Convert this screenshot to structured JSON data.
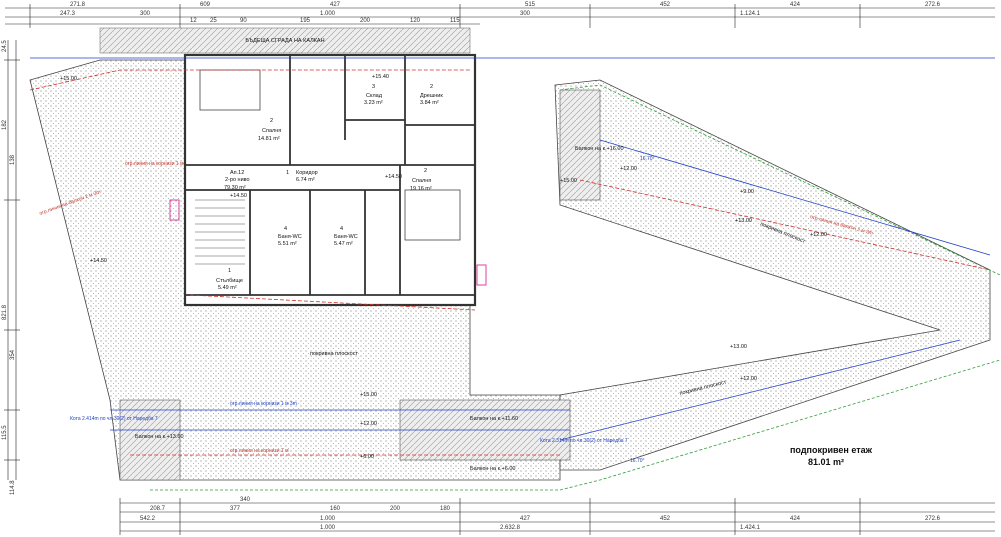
{
  "plan": {
    "floor_title": "подпокривен етаж",
    "floor_area": "81.01 m²",
    "neighbor_building": "БЪДЕЩА СГРАДА НА КАЛКАН",
    "apartment": {
      "name": "Ап.12",
      "type": "2-ро ниво",
      "area": "79.30 m²",
      "level": "+14.50"
    },
    "rooms": [
      {
        "id": "bedroom_1",
        "num": "2",
        "name": "Спалня",
        "area": "14.81 m²"
      },
      {
        "id": "storage",
        "num": "3",
        "name": "Склад",
        "area": "3.23 m²"
      },
      {
        "id": "dressing",
        "num": "2",
        "name": "Дрешник",
        "area": "3.84 m²"
      },
      {
        "id": "corridor",
        "num": "1",
        "name": "Коридор",
        "area": "6.74 m²"
      },
      {
        "id": "bedroom_2",
        "num": "2",
        "name": "Спалня",
        "area": "19.16 m²"
      },
      {
        "id": "bath_1",
        "num": "4",
        "name": "Баня-WC",
        "area": "5.51 m²"
      },
      {
        "id": "bath_2",
        "num": "4",
        "name": "Баня-WC",
        "area": "5.47 m²"
      },
      {
        "id": "stairwell",
        "num": "1",
        "name": "Стълбище",
        "area": "5.49 m²"
      }
    ],
    "levels": [
      "+15.00",
      "+15.40",
      "+14.50",
      "+14.50",
      "+15.00",
      "+12.00",
      "+9.00",
      "+13.00",
      "+12.00",
      "+13.00",
      "+12.00",
      "+15.00",
      "+11.60",
      "+12.00",
      "+9.00",
      "+9.00",
      "+6.00"
    ],
    "top_dimensions_row1": [
      "271.8",
      "609",
      "427",
      "515",
      "452",
      "424",
      "272.6"
    ],
    "top_dimensions_row2": [
      "247.3",
      "300",
      "1.000",
      "300",
      "1.124.1"
    ],
    "top_dimensions_row3": [
      "12",
      "25",
      "90",
      "195",
      "200",
      "120",
      "115"
    ],
    "bottom_dimensions_row1": [
      "208.7",
      "340",
      "377",
      "160",
      "200",
      "180"
    ],
    "bottom_dimensions_row2": [
      "542.2",
      "1.000",
      "427",
      "452",
      "424",
      "272.6"
    ],
    "bottom_dimensions_row3": [
      "1.000",
      "2.632.8",
      "1.424.1"
    ],
    "left_dimensions": [
      "24.5",
      "182",
      "138",
      "821.8",
      "354",
      "115.5",
      "114.8"
    ],
    "balconies": [
      "Балкон на к.+16.00",
      "Балкон на к.+11.60",
      "Балкон на к.+6.00",
      "Балкон на к.+13.60"
    ],
    "notes_red": [
      "огр.линия на балкон 2 м 3m",
      "огр.линия на корнизи 1 м",
      "огр.линия на балкон 2 м 3m",
      "огр.линия на корнизи 1 м"
    ],
    "notes_blue": [
      "Кота 2.414m по чл.30(2) от Наредба 7",
      "Кота 2.314m по чл.30(2) от Наредба 7",
      "огр.линия на корнизи 1 м 3m"
    ],
    "angles": [
      "16.70°",
      "16.70°"
    ],
    "roof_labels": [
      "покривна плоскост",
      "покривна плоскост",
      "покривна плоскост"
    ]
  },
  "colors": {
    "hatch": "#9a9a9a",
    "wall": "#333333",
    "dim_line": "#222222",
    "red_line": "#d0312d",
    "blue_line": "#2140c8",
    "green_line": "#2e9d3a",
    "pink": "#e040a0"
  }
}
